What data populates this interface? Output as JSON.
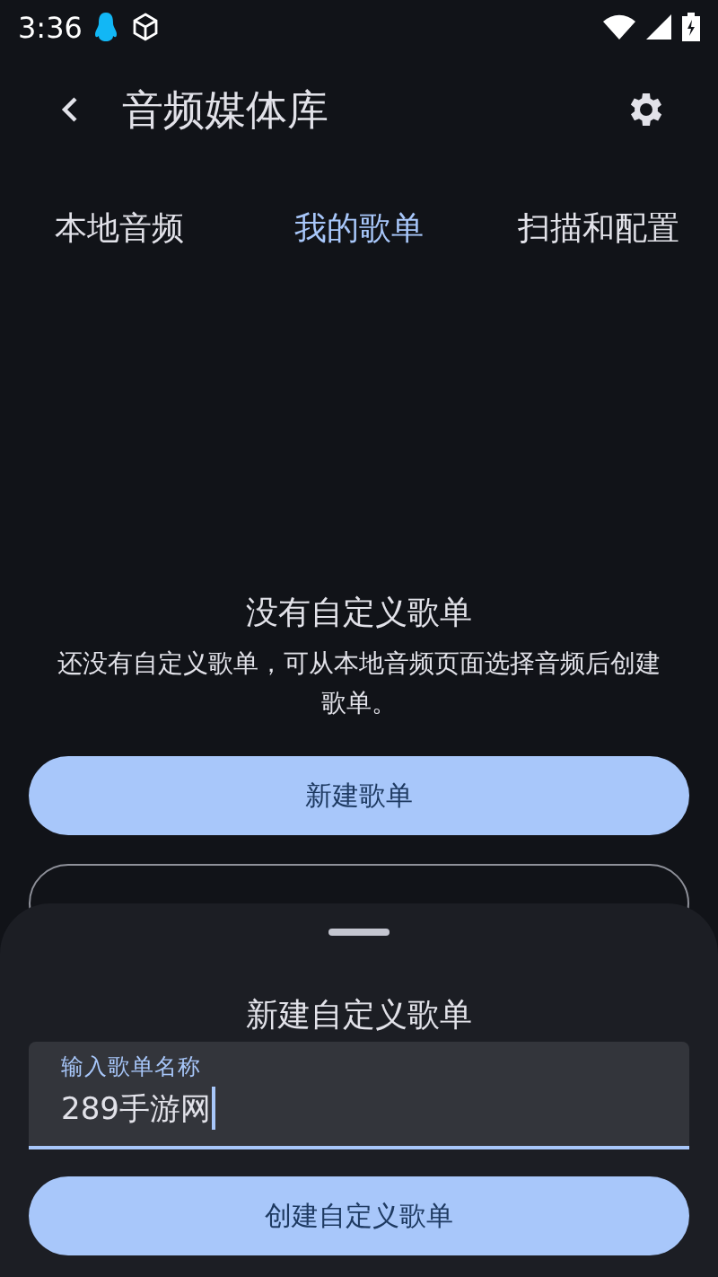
{
  "status_bar": {
    "time": "3:36"
  },
  "app_bar": {
    "title": "音频媒体库"
  },
  "tabs": [
    {
      "label": "本地音频",
      "selected": false
    },
    {
      "label": "我的歌单",
      "selected": true
    },
    {
      "label": "扫描和配置",
      "selected": false
    }
  ],
  "empty_state": {
    "title": "没有自定义歌单",
    "message": "还没有自定义歌单，可从本地音频页面选择音频后创建歌单。"
  },
  "buttons": [
    {
      "kind": "filled",
      "label": "新建歌单"
    },
    {
      "kind": "outlined"
    }
  ],
  "sheet": {
    "title": "新建自定义歌单",
    "field": {
      "label": "输入歌单名称",
      "value": "289手游网",
      "focused": true
    },
    "button": "创建自定义歌单"
  }
}
